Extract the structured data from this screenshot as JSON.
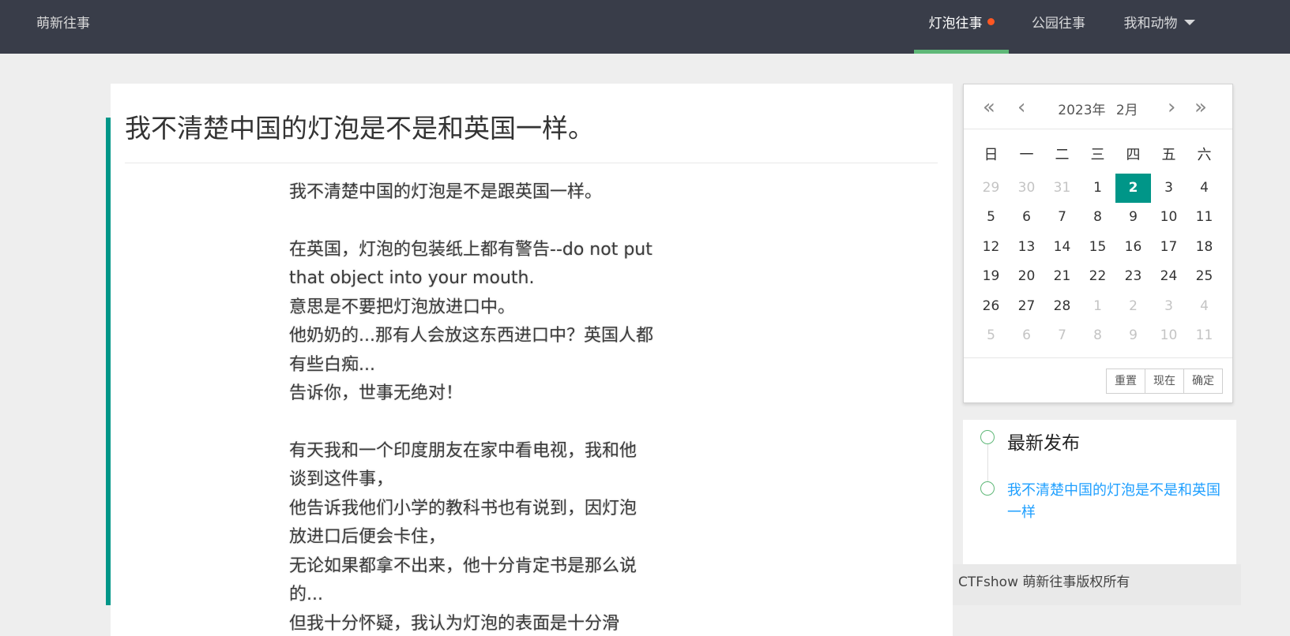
{
  "header": {
    "brand": "萌新往事",
    "nav": [
      {
        "label": "灯泡往事",
        "active": true
      },
      {
        "label": "公园往事",
        "active": false
      },
      {
        "label": "我和动物",
        "active": false
      }
    ],
    "accent_color": "#5fb878",
    "badge_color": "#ff5722"
  },
  "article": {
    "title": "我不清楚中国的灯泡是不是和英国一样。",
    "lines": [
      "我不清楚中国的灯泡是不是跟英国一样。",
      "",
      "在英国，灯泡的包装纸上都有警告--do not put",
      "that object into your mouth.",
      "意思是不要把灯泡放进口中。",
      "他奶奶的...那有人会放这东西进口中？英国人都",
      "有些白痴...",
      "告诉你，世事无绝对！",
      "",
      "有天我和一个印度朋友在家中看电视，我和他",
      "谈到这件事，",
      "他告诉我他们小学的教科书也有说到，因灯泡",
      "放进口后便会卡住，",
      "无论如果都拿不出来，他十分肯定书是那么说",
      "的...",
      "但我十分怀疑，我认为灯泡的表面是十分滑"
    ]
  },
  "calendar": {
    "year_label": "2023年",
    "month_label": "2月",
    "weekdays": [
      "日",
      "一",
      "二",
      "三",
      "四",
      "五",
      "六"
    ],
    "weeks": [
      [
        {
          "d": "29",
          "m": true
        },
        {
          "d": "30",
          "m": true
        },
        {
          "d": "31",
          "m": true
        },
        {
          "d": "1"
        },
        {
          "d": "2",
          "s": true
        },
        {
          "d": "3"
        },
        {
          "d": "4"
        }
      ],
      [
        {
          "d": "5"
        },
        {
          "d": "6"
        },
        {
          "d": "7"
        },
        {
          "d": "8"
        },
        {
          "d": "9"
        },
        {
          "d": "10"
        },
        {
          "d": "11"
        }
      ],
      [
        {
          "d": "12"
        },
        {
          "d": "13"
        },
        {
          "d": "14"
        },
        {
          "d": "15"
        },
        {
          "d": "16"
        },
        {
          "d": "17"
        },
        {
          "d": "18"
        }
      ],
      [
        {
          "d": "19"
        },
        {
          "d": "20"
        },
        {
          "d": "21"
        },
        {
          "d": "22"
        },
        {
          "d": "23"
        },
        {
          "d": "24"
        },
        {
          "d": "25"
        }
      ],
      [
        {
          "d": "26"
        },
        {
          "d": "27"
        },
        {
          "d": "28"
        },
        {
          "d": "1",
          "m": true
        },
        {
          "d": "2",
          "m": true
        },
        {
          "d": "3",
          "m": true
        },
        {
          "d": "4",
          "m": true
        }
      ],
      [
        {
          "d": "5",
          "m": true
        },
        {
          "d": "6",
          "m": true
        },
        {
          "d": "7",
          "m": true
        },
        {
          "d": "8",
          "m": true
        },
        {
          "d": "9",
          "m": true
        },
        {
          "d": "10",
          "m": true
        },
        {
          "d": "11",
          "m": true
        }
      ]
    ],
    "buttons": {
      "reset": "重置",
      "now": "现在",
      "confirm": "确定"
    },
    "selected_color": "#009688"
  },
  "latest": {
    "title": "最新发布",
    "link": "我不清楚中国的灯泡是不是和英国一样"
  },
  "footer": {
    "copyright": "CTFshow 萌新往事版权所有"
  }
}
